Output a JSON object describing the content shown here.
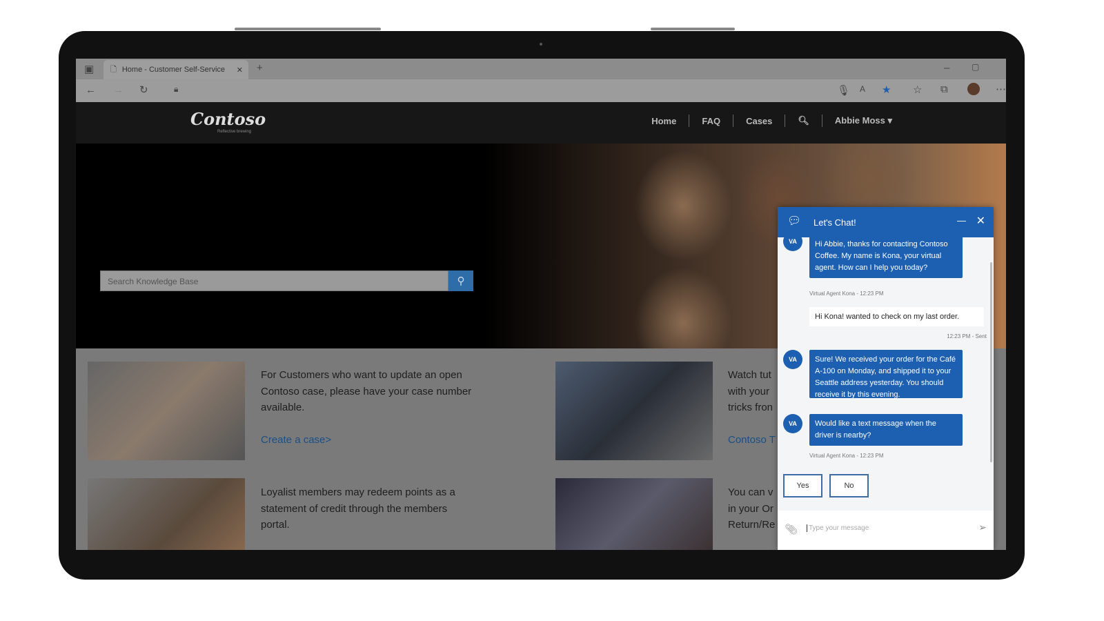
{
  "browser": {
    "tab_title": "Home - Customer Self-Service",
    "new_tab": "+",
    "accent": "#1d5fb0"
  },
  "site": {
    "logo": "Contoso",
    "tagline": "Reflective brewing",
    "nav": [
      "Home",
      "FAQ",
      "Cases"
    ],
    "user": "Abbie Moss ▾"
  },
  "hero": {
    "search_placeholder": "Search Knowledge Base"
  },
  "cards": [
    {
      "text": "For Customers who want to update an open\nContoso case, please have your case number\navailable.",
      "link": "Create a case>"
    },
    {
      "text": "Loyalist members may redeem points as a\nstatement of credit through the members\nportal."
    },
    {
      "text": "Watch tut\nwith your\ntricks fron",
      "link": "Contoso T"
    },
    {
      "text": "You can v\nin your Or\nReturn/Re"
    }
  ],
  "chat": {
    "title": "Let's Chat!",
    "avatar": "VA",
    "messages": [
      {
        "from": "agent",
        "text": "Hi Abbie, thanks for contacting Contoso Coffee. My name is Kona, your virtual agent. How can I help you today?",
        "meta": "Virtual Agent Kona - 12:23 PM"
      },
      {
        "from": "user",
        "text": "Hi Kona! wanted to check on my last order.",
        "meta": "12:23 PM - Sent"
      },
      {
        "from": "agent",
        "text": "Sure! We received your order for the Café A-100 on Monday, and shipped it to your Seattle address yesterday. You should receive it by this evening."
      },
      {
        "from": "agent",
        "text": "Would like a text message when the driver is nearby?",
        "meta": "Virtual Agent Kona - 12:23 PM"
      }
    ],
    "quick_replies": [
      "Yes",
      "No"
    ],
    "input_placeholder": "Type your message"
  }
}
